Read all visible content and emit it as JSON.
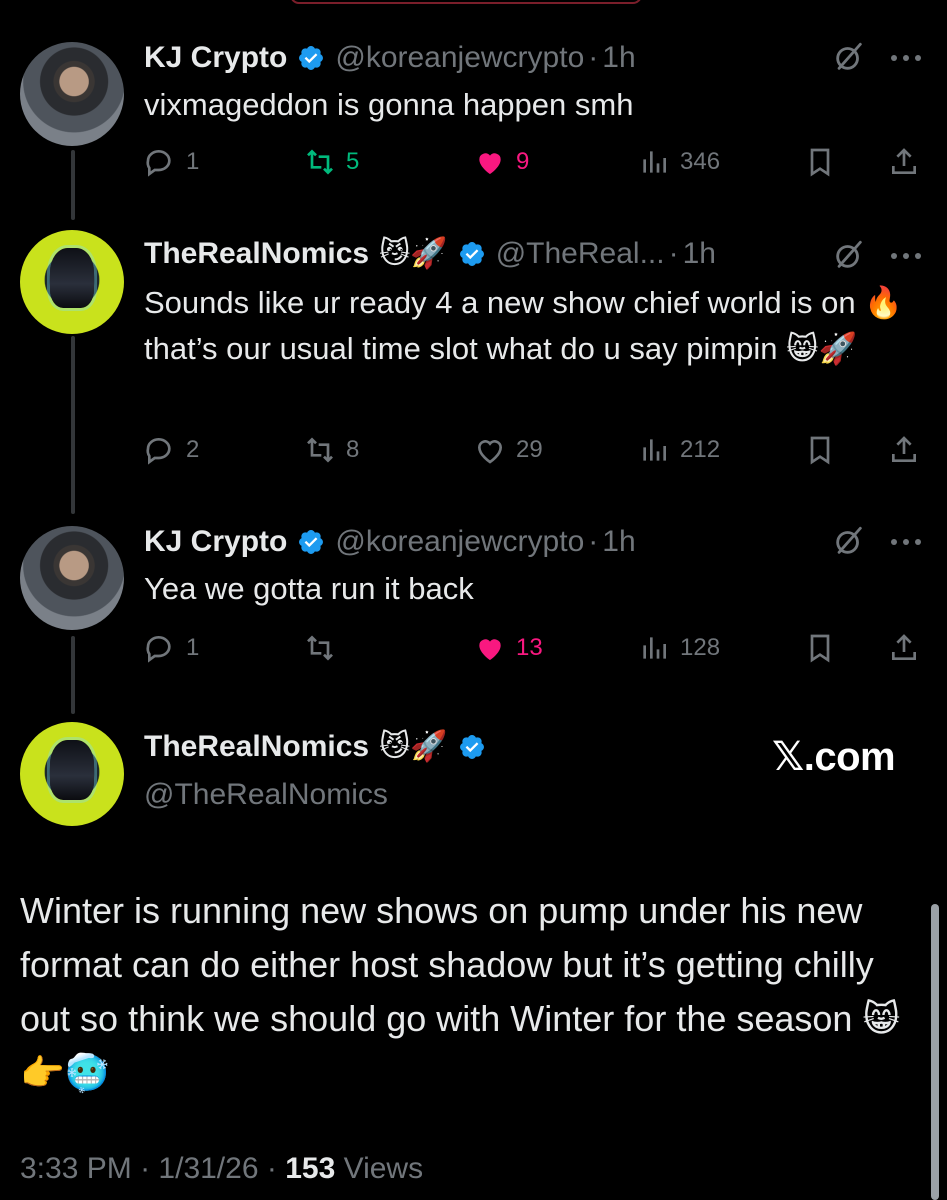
{
  "colors": {
    "background": "#000000",
    "text": "#e7e9ea",
    "secondary": "#71767b",
    "verified": "#1d9bf0",
    "like": "#f91880",
    "retweet": "#00ba7c",
    "thread_line": "#333639"
  },
  "replies": [
    {
      "author": "KJ Crypto",
      "handle": "@koreanjewcrypto",
      "separator": "·",
      "time": "1h",
      "text": "vixmageddon is gonna happen smh",
      "reply_count": "1",
      "retweet_count": "5",
      "like_count": "9",
      "view_count": "346",
      "liked": true,
      "retweeted": true,
      "icons": [
        "reply-icon",
        "retweet-icon",
        "heart-icon",
        "views-icon",
        "bookmark-icon",
        "share-icon",
        "grok-icon",
        "more-icon",
        "verified-badge-icon"
      ]
    },
    {
      "author": "TheRealNomics",
      "author_emoji": "😼🚀",
      "handle": "@TheReal...",
      "separator": "·",
      "time": "1h",
      "text": "Sounds like ur ready 4 a new show chief world is on 🔥 that’s our usual time slot what do u say pimpin 😸🚀",
      "reply_count": "2",
      "retweet_count": "8",
      "like_count": "29",
      "view_count": "212",
      "liked": false,
      "retweeted": false
    },
    {
      "author": "KJ Crypto",
      "handle": "@koreanjewcrypto",
      "separator": "·",
      "time": "1h",
      "text": "Yea we gotta run it back",
      "reply_count": "1",
      "retweet_count": "",
      "like_count": "13",
      "view_count": "128",
      "liked": true,
      "retweeted": false
    }
  ],
  "main_tweet": {
    "author": "TheRealNomics",
    "author_emoji": "😼🚀",
    "handle": "@TheRealNomics",
    "brand": "𝕏.com",
    "text": "Winter is running new shows on pump under his new format can do either host shadow but it’s getting chilly out so think we should go with Winter for the season 😸👉🥶",
    "time": "3:33 PM",
    "date": "1/31/26",
    "separator": "·",
    "views_count": "153",
    "views_label": "Views"
  }
}
